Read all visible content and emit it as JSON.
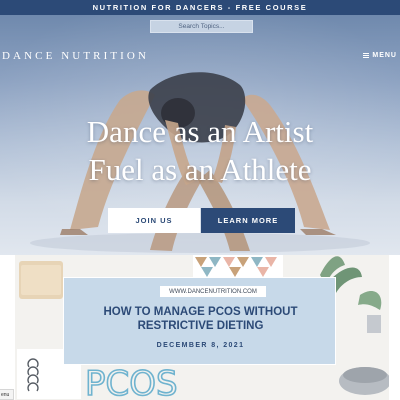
{
  "announcement": {
    "text": "NUTRITION FOR DANCERS - FREE COURSE"
  },
  "search": {
    "placeholder": "Search Topics..."
  },
  "header": {
    "logo": "DANCE NUTRITION",
    "menu_label": "MENU"
  },
  "hero": {
    "headline_line1": "Dance as an Artist",
    "headline_line2": "Fuel as an Athlete",
    "join_label": "JOIN US",
    "learn_label": "LEARN MORE"
  },
  "featured_post": {
    "source": "WWW.DANCENUTRITION.COM",
    "title_line1": "HOW TO MANAGE PCOS WITHOUT",
    "title_line2": "RESTRICTIVE DIETING",
    "date": "DECEMBER 8, 2021",
    "image_text": "PCOS"
  },
  "corner_tab": {
    "label": "enu"
  },
  "colors": {
    "brand_navy": "#2c4a77",
    "card_blue": "#c7d9e9",
    "white": "#ffffff"
  }
}
